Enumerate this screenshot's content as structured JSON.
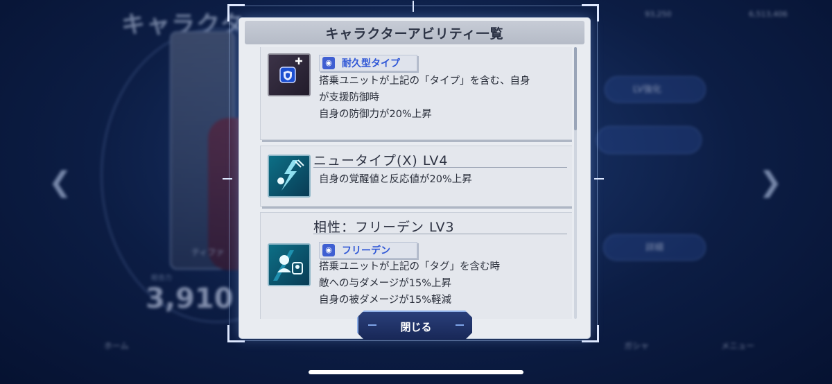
{
  "background": {
    "screen_title": "キャラクター",
    "type_label": "ティファ",
    "power_label": "総合力",
    "power_value": "3,910",
    "lv_button": "LV強化",
    "detail_button": "詳細",
    "stats": [
      "93,250",
      "6,513,406"
    ],
    "nav": {
      "home": "ホーム",
      "gacha": "ガシャ",
      "menu": "メニュー"
    }
  },
  "dialog": {
    "title": "キャラクターアビリティ一覧",
    "close_label": "閉じる"
  },
  "abilities": [
    {
      "tag": "耐久型タイプ",
      "lines": [
        "搭乗ユニットが上記の「タイプ」を含む、自身",
        "が支援防御時",
        "自身の防御力が20%上昇"
      ]
    },
    {
      "title": "ニュータイプ(X) LV4",
      "lines": [
        "自身の覚醒値と反応値が20%上昇"
      ]
    },
    {
      "title": "相性：フリーデン LV3",
      "tag": "フリーデン",
      "lines": [
        "搭乗ユニットが上記の「タグ」を含む時",
        "敵への与ダメージが15%上昇",
        "自身の被ダメージが15%軽減"
      ]
    }
  ],
  "colors": {
    "tag_text": "#2f57d6",
    "dialog_bg": "#e9ecf1",
    "button_bg": "#1e3168"
  },
  "icons": [
    "shield-plus-icon",
    "newtype-flash-icon",
    "pilot-affinity-icon",
    "tag-type-icon",
    "tag-group-icon"
  ]
}
